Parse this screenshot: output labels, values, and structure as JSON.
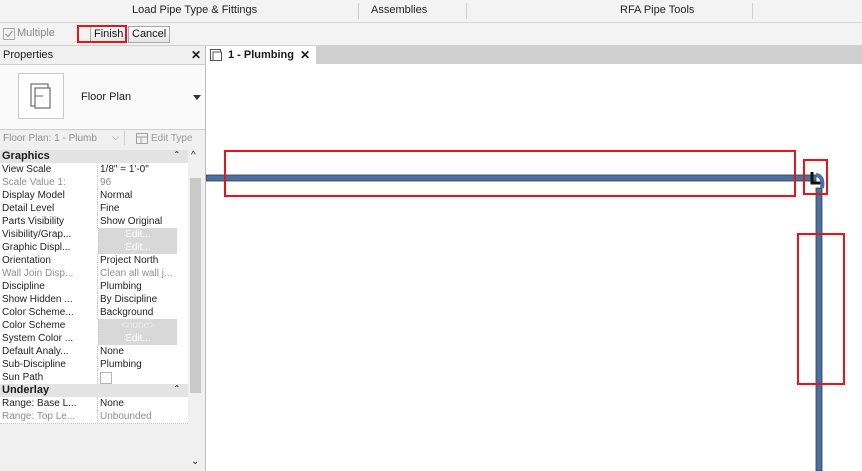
{
  "ribbon": {
    "tabs": [
      "Load Pipe Type & Fittings",
      "Assemblies",
      "RFA Pipe Tools"
    ]
  },
  "options_bar": {
    "multiple_label": "Multiple",
    "finish_label": "Finish",
    "cancel_label": "Cancel"
  },
  "properties": {
    "title": "Properties",
    "close_glyph": "✕",
    "type_name": "Floor Plan",
    "instance_selector": "Floor Plan: 1 - Plumb",
    "edit_type_label": "Edit Type",
    "groups": [
      {
        "name": "Graphics",
        "rows": [
          {
            "name": "View Scale",
            "value": "1/8\" = 1'-0\"",
            "dim": false,
            "kind": "text"
          },
          {
            "name": "Scale Value    1:",
            "value": "96",
            "dim": true,
            "kind": "text"
          },
          {
            "name": "Display Model",
            "value": "Normal",
            "dim": false,
            "kind": "text"
          },
          {
            "name": "Detail Level",
            "value": "Fine",
            "dim": false,
            "kind": "text"
          },
          {
            "name": "Parts Visibility",
            "value": "Show Original",
            "dim": false,
            "kind": "text"
          },
          {
            "name": "Visibility/Grap...",
            "value": "Edit...",
            "dim": false,
            "kind": "edit"
          },
          {
            "name": "Graphic Displ...",
            "value": "Edit...",
            "dim": false,
            "kind": "edit"
          },
          {
            "name": "Orientation",
            "value": "Project North",
            "dim": false,
            "kind": "text"
          },
          {
            "name": "Wall Join Disp...",
            "value": "Clean all wall j...",
            "dim": true,
            "kind": "text"
          },
          {
            "name": "Discipline",
            "value": "Plumbing",
            "dim": false,
            "kind": "text"
          },
          {
            "name": "Show Hidden ...",
            "value": "By Discipline",
            "dim": false,
            "kind": "text"
          },
          {
            "name": "Color Scheme...",
            "value": "Background",
            "dim": false,
            "kind": "text"
          },
          {
            "name": "Color Scheme",
            "value": "<none>",
            "dim": false,
            "kind": "none"
          },
          {
            "name": "System Color ...",
            "value": "Edit...",
            "dim": false,
            "kind": "edit"
          },
          {
            "name": "Default Analy...",
            "value": "None",
            "dim": false,
            "kind": "text"
          },
          {
            "name": "Sub-Discipline",
            "value": "Plumbing",
            "dim": false,
            "kind": "text"
          },
          {
            "name": "Sun Path",
            "value": "",
            "dim": false,
            "kind": "checkbox"
          }
        ]
      },
      {
        "name": "Underlay",
        "rows": [
          {
            "name": "Range: Base L...",
            "value": "None",
            "dim": false,
            "kind": "text"
          },
          {
            "name": "Range: Top Le...",
            "value": "Unbounded",
            "dim": false,
            "kind": "text"
          }
        ]
      }
    ]
  },
  "view_tab": {
    "label": "1 - Plumbing",
    "close_glyph": "✕"
  },
  "colors": {
    "pipe": "#4a6fa5",
    "pipe_outline": "#3b3b3b",
    "highlight": "#e8141c"
  }
}
